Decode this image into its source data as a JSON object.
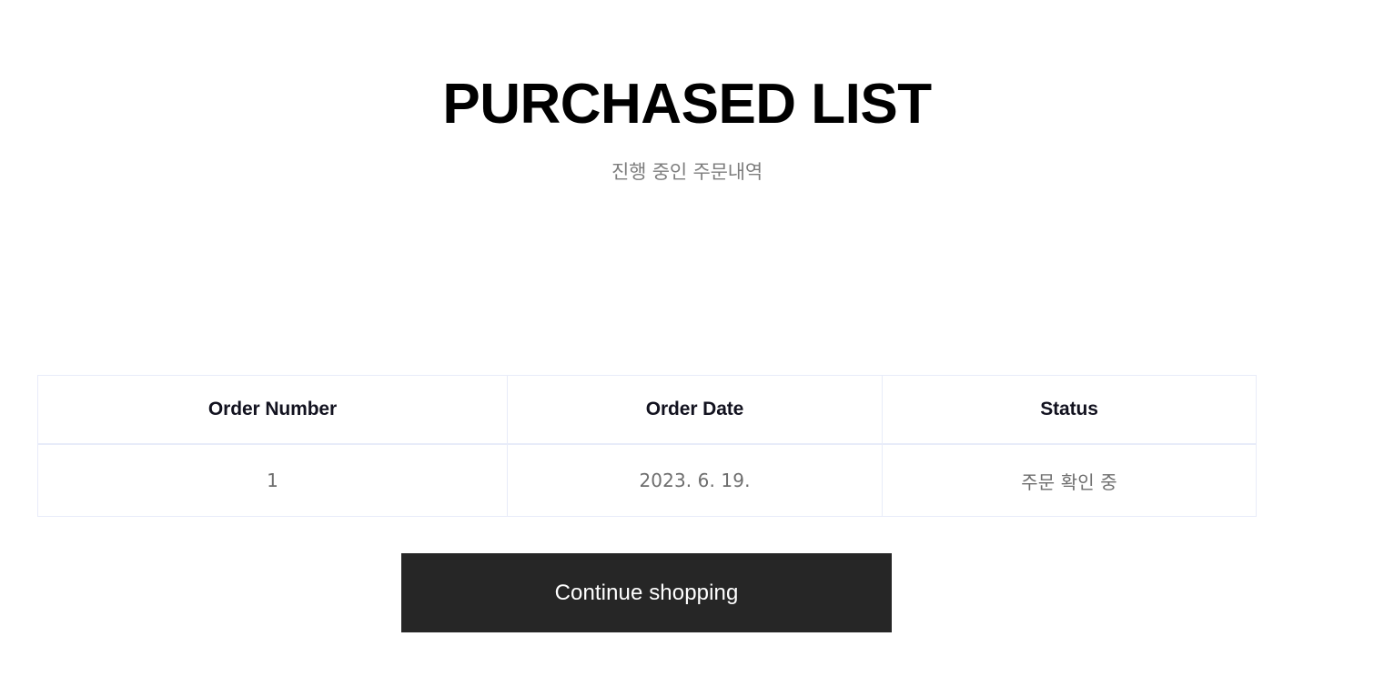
{
  "header": {
    "title": "PURCHASED LIST",
    "subtitle": "진행 중인 주문내역"
  },
  "orders_table": {
    "columns": [
      {
        "key": "order_number",
        "label": "Order Number"
      },
      {
        "key": "order_date",
        "label": "Order Date"
      },
      {
        "key": "status",
        "label": "Status"
      }
    ],
    "rows": [
      {
        "order_number": "1",
        "order_date": "2023. 6. 19.",
        "status": "주문 확인 중"
      }
    ]
  },
  "actions": {
    "continue_shopping_label": "Continue shopping"
  },
  "colors": {
    "page_background": "#ffffff",
    "title_text": "#000000",
    "subtitle_text": "#7d7d7d",
    "table_border": "#e8ecf9",
    "table_header_text": "#12121f",
    "table_cell_text": "#6e6e6e",
    "button_background": "#262626",
    "button_text": "#ffffff"
  }
}
